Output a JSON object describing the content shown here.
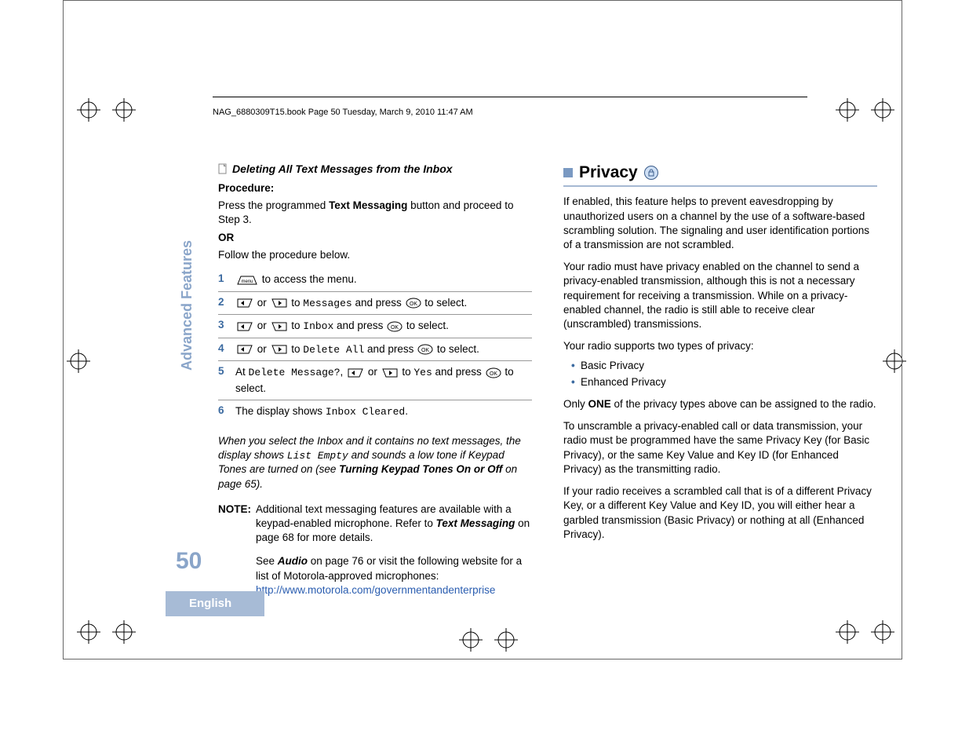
{
  "header": {
    "text": "NAG_6880309T15.book  Page 50  Tuesday, March 9, 2010  11:47 AM"
  },
  "sidebar": {
    "section": "Advanced Features",
    "page_number": "50",
    "language": "English"
  },
  "left": {
    "sub_heading": "Deleting All Text Messages from the Inbox",
    "procedure_label": "Procedure:",
    "intro_a_pre": "Press the programmed ",
    "intro_a_bold": "Text Messaging",
    "intro_a_post": " button and proceed to Step 3.",
    "or_label": "OR",
    "intro_b": "Follow the procedure below.",
    "steps": [
      {
        "n": "1",
        "pre": "",
        "mid": " to access the menu."
      },
      {
        "n": "2",
        "pre": "",
        "t1": "Messages",
        "mid": " and press ",
        "post": " to select."
      },
      {
        "n": "3",
        "pre": "",
        "t1": "Inbox",
        "mid": " and press ",
        "post": " to select."
      },
      {
        "n": "4",
        "pre": "",
        "t1": "Delete All",
        "mid": " and press ",
        "post": " to select."
      },
      {
        "n": "5",
        "pre": "At ",
        "q": "Delete Message?",
        "t1": "Yes",
        "mid": " and press ",
        "post": " to select."
      },
      {
        "n": "6",
        "pre": "The display shows ",
        "t1": "Inbox Cleared",
        "post": "."
      }
    ],
    "italic_note_1": "When you select the Inbox and it contains no text messages, the display shows ",
    "italic_mono": "List Empty",
    "italic_note_2": " and sounds a low tone if Keypad Tones are turned on (see ",
    "italic_bold": "Turning Keypad Tones On or Off",
    "italic_note_3": " on page 65).",
    "note_label": "NOTE:",
    "note_body_1": "Additional text messaging features are available with a keypad-enabled microphone. Refer to ",
    "note_bold": "Text Messaging",
    "note_body_2": " on page 68 for more details.",
    "see_1": "See ",
    "see_bold": "Audio",
    "see_2": " on page 76 or visit the following website for a list of Motorola-approved microphones:",
    "url": "http://www.motorola.com/governmentandenterprise"
  },
  "right": {
    "title": "Privacy",
    "p1": "If enabled, this feature helps to prevent eavesdropping by unauthorized users on a channel by the use of a software-based scrambling solution. The signaling and user identification portions of a transmission are not scrambled.",
    "p2": "Your radio must have privacy enabled on the channel to send a privacy-enabled transmission, although this is not a necessary requirement for receiving a transmission. While on a privacy-enabled channel, the radio is still able to receive clear (unscrambled) transmissions.",
    "p3": "Your radio supports two types of privacy:",
    "bullets": [
      "Basic Privacy",
      "Enhanced Privacy"
    ],
    "p4_a": "Only ",
    "p4_b": "ONE",
    "p4_c": " of the privacy types above can be assigned to the radio.",
    "p5": "To unscramble a privacy-enabled call or data transmission, your radio must be programmed have the same Privacy Key (for Basic Privacy), or the same Key Value and Key ID (for Enhanced Privacy) as the transmitting radio.",
    "p6": "If your radio receives a scrambled call that is of a different Privacy Key, or a different Key Value and Key ID, you will either hear a garbled transmission (Basic Privacy) or nothing at all (Enhanced Privacy)."
  }
}
